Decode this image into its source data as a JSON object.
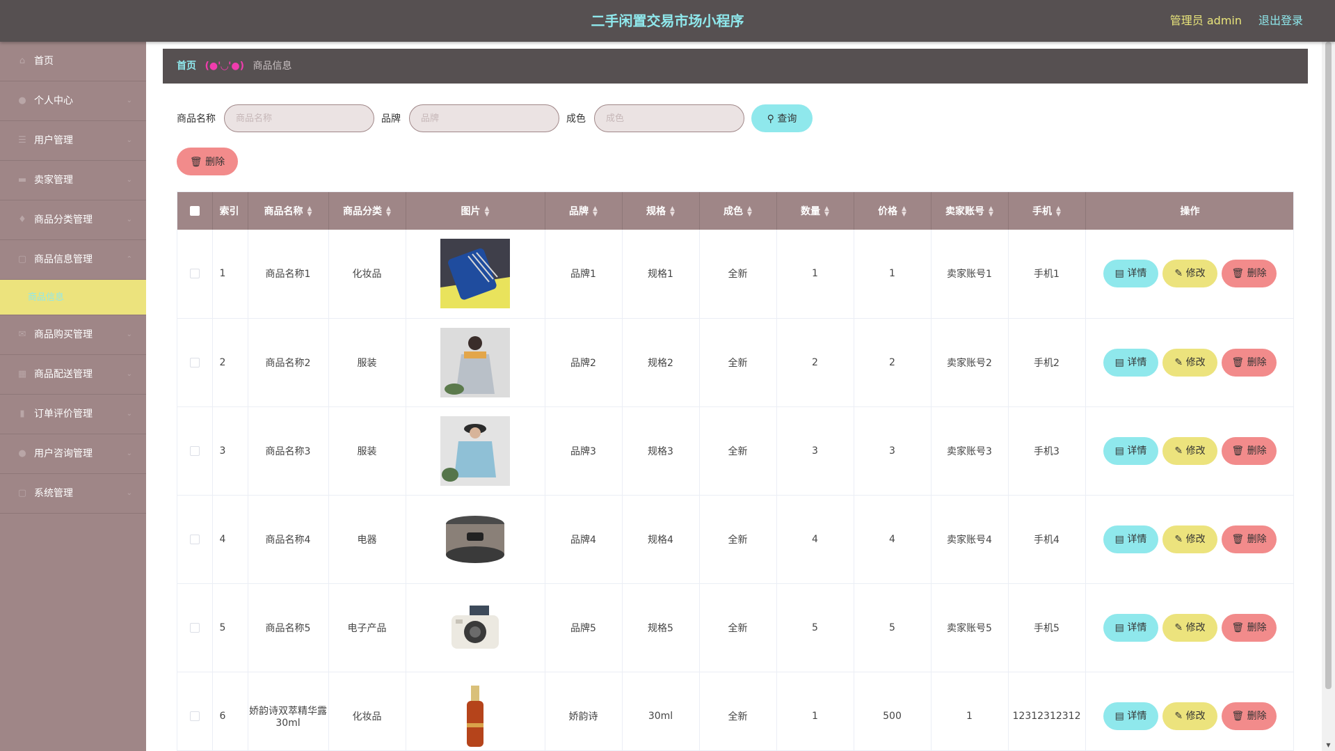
{
  "header": {
    "title": "二手闲置交易市场小程序",
    "admin": "管理员 admin",
    "logout": "退出登录"
  },
  "sidebar": {
    "items": [
      {
        "label": "首页",
        "icon": "home-icon",
        "chevron": false
      },
      {
        "label": "个人中心",
        "icon": "user-icon",
        "chevron": true
      },
      {
        "label": "用户管理",
        "icon": "list-icon",
        "chevron": true
      },
      {
        "label": "卖家管理",
        "icon": "store-icon",
        "chevron": true
      },
      {
        "label": "商品分类管理",
        "icon": "lightbulb-icon",
        "chevron": true
      },
      {
        "label": "商品信息管理",
        "icon": "doc-icon",
        "chevron": true,
        "expanded": true
      },
      {
        "label": "商品购买管理",
        "icon": "mail-icon",
        "chevron": true
      },
      {
        "label": "商品配送管理",
        "icon": "grid-icon",
        "chevron": true
      },
      {
        "label": "订单评价管理",
        "icon": "chart-icon",
        "chevron": true
      },
      {
        "label": "用户咨询管理",
        "icon": "person-icon",
        "chevron": true
      },
      {
        "label": "系统管理",
        "icon": "settings-icon",
        "chevron": true
      }
    ],
    "active_sub": "商品信息"
  },
  "breadcrumb": {
    "home": "首页",
    "separator": "(●'◡'●)",
    "current": "商品信息"
  },
  "search": {
    "name_label": "商品名称",
    "name_placeholder": "商品名称",
    "brand_label": "品牌",
    "brand_placeholder": "品牌",
    "condition_label": "成色",
    "condition_placeholder": "成色",
    "query_label": "查询",
    "batch_delete_label": "删除"
  },
  "table": {
    "columns": [
      "索引",
      "商品名称",
      "商品分类",
      "图片",
      "品牌",
      "规格",
      "成色",
      "数量",
      "价格",
      "卖家账号",
      "手机",
      "操作"
    ],
    "actions": {
      "detail": "详情",
      "edit": "修改",
      "delete": "删除"
    },
    "rows": [
      {
        "index": "1",
        "name": "商品名称1",
        "category": "化妆品",
        "image": "brush-set",
        "brand": "品牌1",
        "spec": "规格1",
        "condition": "全新",
        "qty": "1",
        "price": "1",
        "seller": "卖家账号1",
        "phone": "手机1"
      },
      {
        "index": "2",
        "name": "商品名称2",
        "category": "服装",
        "image": "silver-jacket",
        "brand": "品牌2",
        "spec": "规格2",
        "condition": "全新",
        "qty": "2",
        "price": "2",
        "seller": "卖家账号2",
        "phone": "手机2"
      },
      {
        "index": "3",
        "name": "商品名称3",
        "category": "服装",
        "image": "blue-hoodie",
        "brand": "品牌3",
        "spec": "规格3",
        "condition": "全新",
        "qty": "3",
        "price": "3",
        "seller": "卖家账号3",
        "phone": "手机3"
      },
      {
        "index": "4",
        "name": "商品名称4",
        "category": "电器",
        "image": "rice-cooker",
        "brand": "品牌4",
        "spec": "规格4",
        "condition": "全新",
        "qty": "4",
        "price": "4",
        "seller": "卖家账号4",
        "phone": "手机4"
      },
      {
        "index": "5",
        "name": "商品名称5",
        "category": "电子产品",
        "image": "instant-camera",
        "brand": "品牌5",
        "spec": "规格5",
        "condition": "全新",
        "qty": "5",
        "price": "5",
        "seller": "卖家账号5",
        "phone": "手机5"
      },
      {
        "index": "6",
        "name": "娇韵诗双萃精华露30ml",
        "category": "化妆品",
        "image": "serum-bottle",
        "brand": "娇韵诗",
        "spec": "30ml",
        "condition": "全新",
        "qty": "1",
        "price": "500",
        "seller": "1",
        "phone": "12312312312"
      }
    ]
  },
  "colors": {
    "header_bg": "#565051",
    "sidebar_bg": "#9f8687",
    "accent_cyan": "#8fe8ec",
    "accent_yellow": "#ece37d",
    "accent_red": "#f28b8b"
  }
}
